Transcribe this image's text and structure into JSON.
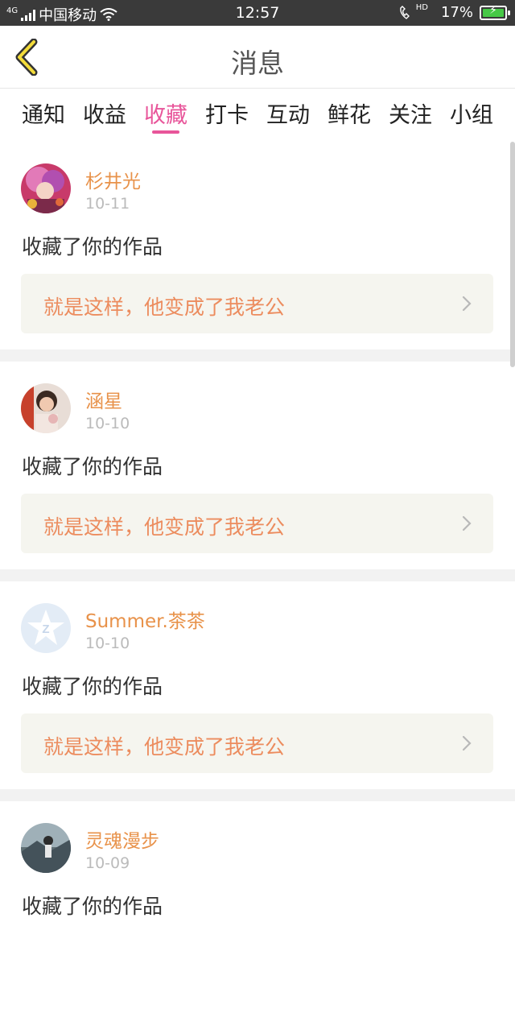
{
  "status_bar": {
    "network": "4G",
    "carrier": "中国移动",
    "time": "12:57",
    "hd": "HD",
    "battery": "17%"
  },
  "header": {
    "title": "消息"
  },
  "tabs": [
    {
      "label": "通知"
    },
    {
      "label": "收益"
    },
    {
      "label": "收藏"
    },
    {
      "label": "打卡"
    },
    {
      "label": "互动"
    },
    {
      "label": "鲜花"
    },
    {
      "label": "关注"
    },
    {
      "label": "小组"
    }
  ],
  "active_tab": "收藏",
  "colors": {
    "accent": "#e8559a",
    "username": "#e8924a",
    "work_title": "#ec8c5e"
  },
  "messages": [
    {
      "user": "杉井光",
      "date": "10-11",
      "action": "收藏了你的作品",
      "work": "就是这样，他变成了我老公",
      "avatar": "anime-girl-avatar"
    },
    {
      "user": "涵星",
      "date": "10-10",
      "action": "收藏了你的作品",
      "work": "就是这样，他变成了我老公",
      "avatar": "photo-avatar"
    },
    {
      "user": "Summer.茶茶",
      "date": "10-10",
      "action": "收藏了你的作品",
      "work": "就是这样，他变成了我老公",
      "avatar": "default-qzone-avatar"
    },
    {
      "user": "灵魂漫步",
      "date": "10-09",
      "action": "收藏了你的作品",
      "work": "",
      "avatar": "landscape-avatar"
    }
  ]
}
